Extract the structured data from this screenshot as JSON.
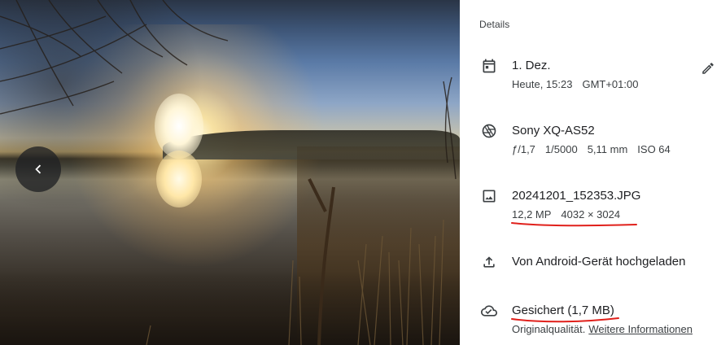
{
  "viewer": {
    "prev_icon": "chevron-left-icon"
  },
  "details": {
    "title": "Details",
    "edit_icon": "pencil-icon",
    "date": {
      "icon": "calendar-icon",
      "primary": "1. Dez.",
      "day": "Heute, 15:23",
      "timezone": "GMT+01:00"
    },
    "camera": {
      "icon": "camera-aperture-icon",
      "primary": "Sony XQ-AS52",
      "aperture": "ƒ/1,7",
      "shutter": "1/5000",
      "focal": "5,11 mm",
      "iso": "ISO 64"
    },
    "file": {
      "icon": "image-icon",
      "primary": "20241201_152353.JPG",
      "megapixels": "12,2 MP",
      "resolution": "4032 × 3024"
    },
    "upload": {
      "icon": "upload-icon",
      "primary": "Von Android-Gerät hochgeladen"
    },
    "backup": {
      "icon": "cloud-done-icon",
      "primary": "Gesichert (1,7 MB)",
      "quality": "Originalqualität.",
      "more_link": "Weitere Informationen"
    }
  },
  "colors": {
    "annotation_red": "#e0201b",
    "text_primary": "#202124",
    "text_secondary": "#3c4043"
  }
}
